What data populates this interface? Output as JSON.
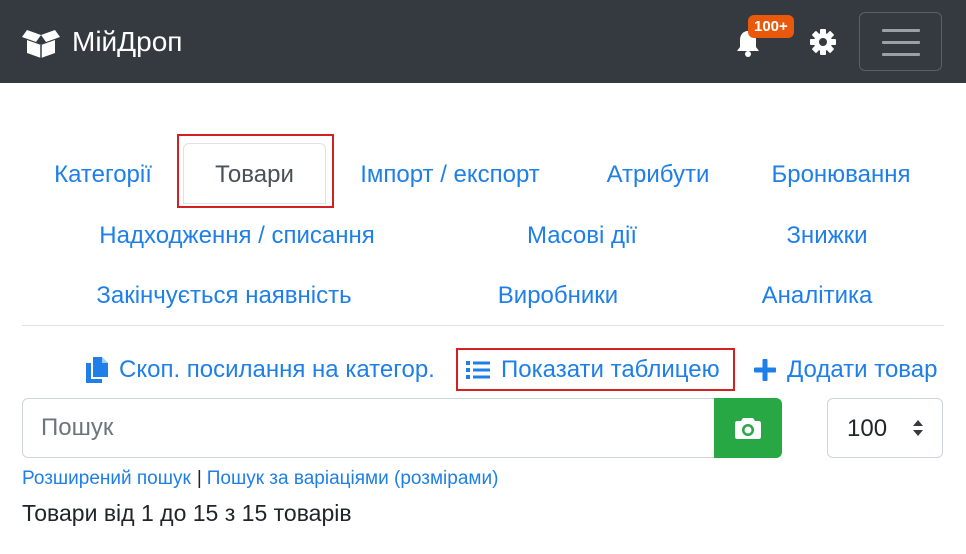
{
  "navbar": {
    "brand": "МійДроп",
    "notifications_badge": "100+",
    "icons": [
      "box-open-icon",
      "bell-icon",
      "gear-icon",
      "hamburger-menu-icon"
    ]
  },
  "tabs": {
    "row1": [
      "Категорії",
      "Товари",
      "Імпорт / експорт",
      "Атрибути",
      "Бронювання"
    ],
    "row2": [
      "Надходження / списання",
      "Масові дії",
      "Знижки"
    ],
    "row3": [
      "Закінчується наявність",
      "Виробники",
      "Аналітика"
    ],
    "active": "Товари"
  },
  "actions": {
    "copy_link": "Скоп. посилання на категор.",
    "show_table": "Показати таблицею",
    "add_product": "Додати товар"
  },
  "search": {
    "placeholder": "Пошук",
    "value": ""
  },
  "per_page": {
    "selected": "100"
  },
  "links": {
    "advanced_search": "Розширений пошук",
    "separator": "|",
    "variation_search": "Пошук за варіаціями (розмірами)"
  },
  "results_text": "Товари від 1 до 15 з 15 товарів",
  "colors": {
    "navbar_bg": "#343a40",
    "link": "#1e7fe8",
    "badge": "#e8590c",
    "camera_button": "#28a745",
    "highlight": "#d42020"
  }
}
